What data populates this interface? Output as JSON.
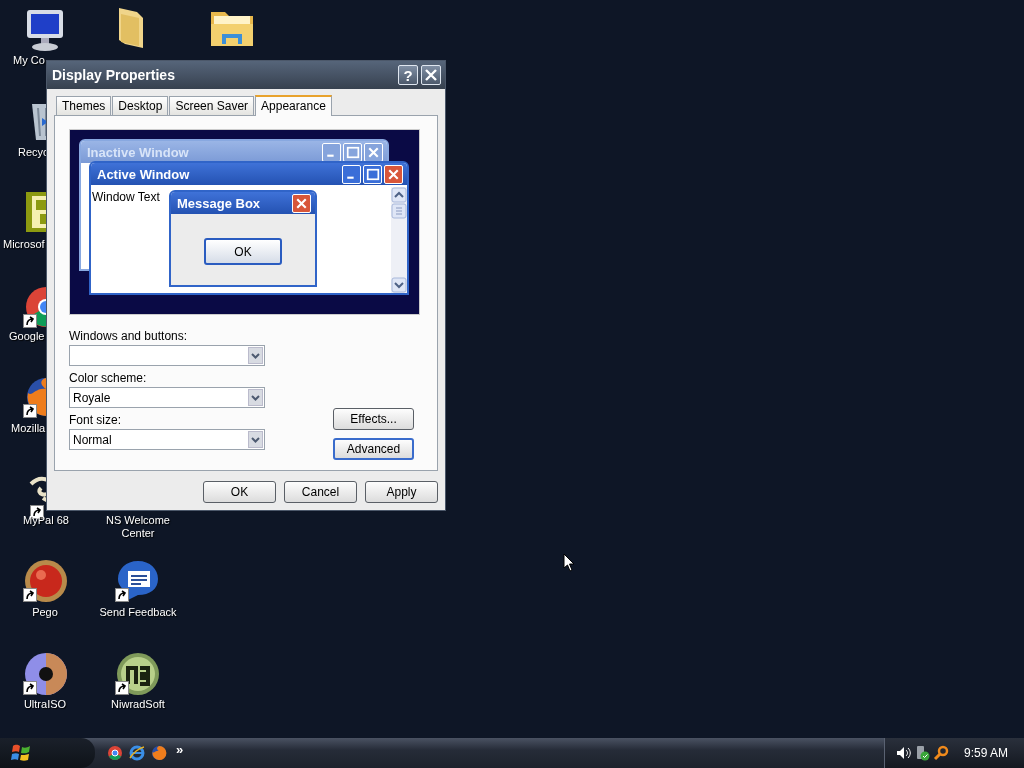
{
  "desktop_icons": [
    {
      "kind": "computer",
      "label": "My Co",
      "shortcut": false
    },
    {
      "kind": "folder",
      "shortcut": false
    },
    {
      "kind": "documents",
      "shortcut": false
    },
    {
      "kind": "recycle",
      "label": "Recyc",
      "shortcut": false
    },
    {
      "kind": "office",
      "label": "Microsof",
      "shortcut": false
    },
    {
      "kind": "chrome",
      "label": "Google",
      "shortcut": true
    },
    {
      "kind": "firefox",
      "label": "Mozilla",
      "shortcut": true
    },
    {
      "kind": "mypal",
      "label": "MyPal 68",
      "shortcut": true
    },
    {
      "kind": "none",
      "label": "NS Welcome Center",
      "shortcut": false
    },
    {
      "kind": "pego",
      "label": "Pego",
      "shortcut": true
    },
    {
      "kind": "feedback",
      "label": "Send Feedback",
      "shortcut": true
    },
    {
      "kind": "disc",
      "label": "UltraISO",
      "shortcut": true
    },
    {
      "kind": "niwrad",
      "label": "NiwradSoft",
      "shortcut": true
    }
  ],
  "dialog": {
    "title": "Display Properties",
    "help_button": "?",
    "tabs": [
      {
        "label": "Themes",
        "selected": false
      },
      {
        "label": "Desktop",
        "selected": false
      },
      {
        "label": "Screen Saver",
        "selected": false
      },
      {
        "label": "Appearance",
        "selected": true
      }
    ],
    "preview": {
      "inactive_window": {
        "title": "Inactive Window"
      },
      "active_window": {
        "title": "Active Window",
        "text": "Window Text"
      },
      "message_box": {
        "title": "Message Box",
        "button": "OK"
      }
    },
    "fields": [
      {
        "label": "Windows and buttons:"
      },
      {
        "label": "Color scheme:",
        "value": "Royale"
      },
      {
        "label": "Font size:",
        "value": "Normal"
      }
    ],
    "side_buttons": [
      {
        "label": "Effects...",
        "focused": false
      },
      {
        "label": "Advanced",
        "focused": true
      }
    ],
    "buttons": [
      "OK",
      "Cancel",
      "Apply"
    ]
  },
  "taskbar": {
    "quick_launch": [
      {
        "kind": "chrome"
      },
      {
        "kind": "ie"
      },
      {
        "kind": "firefox"
      }
    ],
    "more": "»",
    "tray": [
      {
        "kind": "speaker"
      },
      {
        "kind": "usb"
      },
      {
        "kind": "search"
      }
    ],
    "clock": "9:59 AM"
  }
}
